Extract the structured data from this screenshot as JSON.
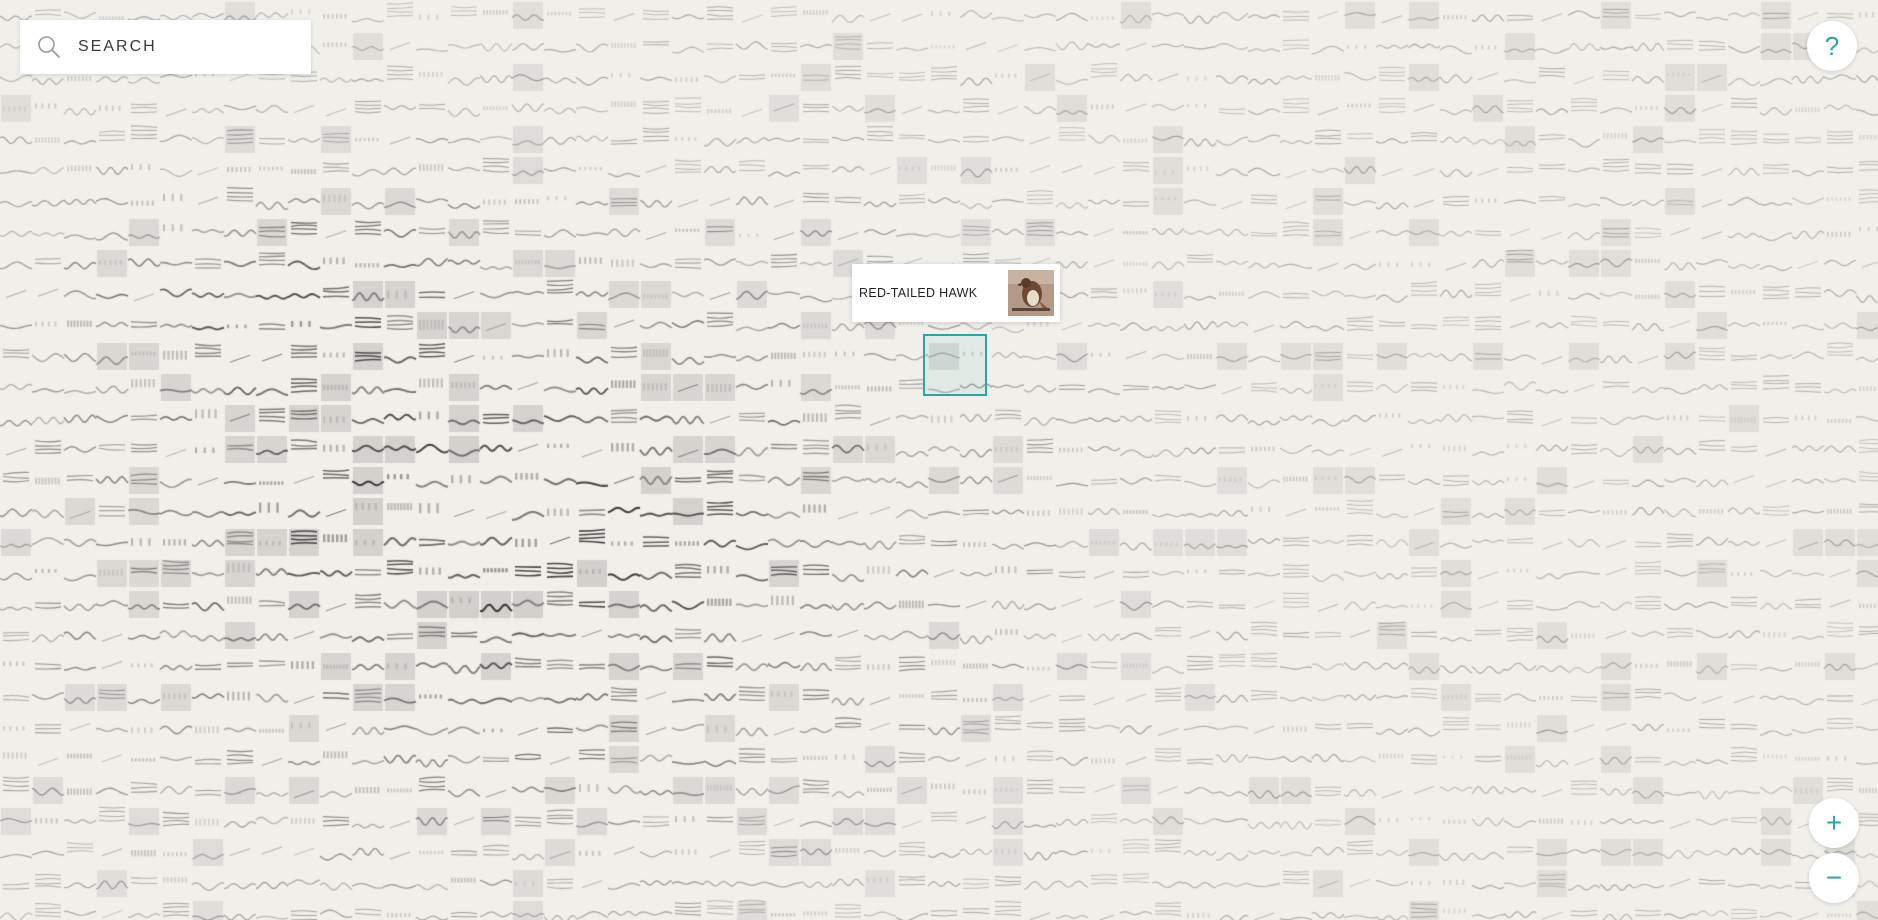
{
  "search": {
    "placeholder": "SEARCH",
    "value": ""
  },
  "help_button": {
    "label": "?"
  },
  "zoom": {
    "in_label": "+",
    "out_label": "−"
  },
  "tooltip": {
    "label": "RED-TAILED HAWK"
  },
  "colors": {
    "background": "#f1efea",
    "accent": "#2aa7a3",
    "ink": "#2b2b2b"
  },
  "icons": {
    "search": "search-icon",
    "help": "question-mark-icon",
    "zoom_in": "plus-icon",
    "zoom_out": "minus-icon"
  }
}
